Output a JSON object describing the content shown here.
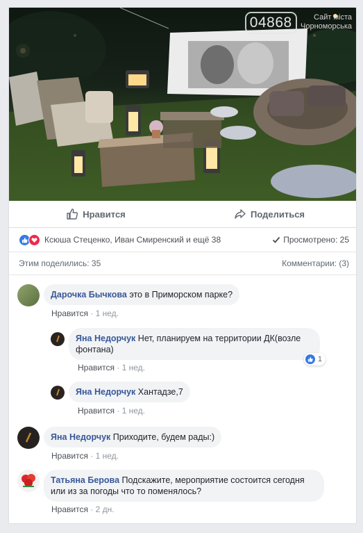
{
  "watermark": {
    "number": "04868",
    "site_line1": "Сайт міста",
    "site_line2": "Чорноморська"
  },
  "actions": {
    "like_label": "Нравится",
    "share_label": "Поделиться"
  },
  "reactions": {
    "names": "Ксюша Стеценко, Иван Смиренский и ещё 38",
    "viewed": "Просмотрено: 25"
  },
  "summary": {
    "shared": "Этим поделились: 35",
    "comments": "Комментарии: (3)"
  },
  "comments": [
    {
      "author": "Дарочка Бычкова",
      "text": "это в Приморском парке?",
      "like": "Нравится",
      "time": "· 1 нед."
    },
    {
      "author": "Яна Недорчук",
      "text": "Нет, планируем на территории ДК(возле фонтана)",
      "like": "Нравится",
      "time": "· 1 нед.",
      "reactions": "1"
    },
    {
      "author": "Яна Недорчук",
      "text": "Хантадзе,7",
      "like": "Нравится",
      "time": "· 1 нед."
    },
    {
      "author": "Яна Недорчук",
      "text": "Приходите, будем рады:)",
      "like": "Нравится",
      "time": "· 1 нед."
    },
    {
      "author": "Татьяна Берова",
      "text": "Подскажите, мероприятие состоится сегодня или из за погоды что то поменялось?",
      "like": "Нравится",
      "time": "· 2 дн."
    }
  ],
  "colors": {
    "link": "#385898",
    "like_blue": "#3578e5",
    "love_red": "#f0284a",
    "bubble": "#f2f3f5"
  }
}
